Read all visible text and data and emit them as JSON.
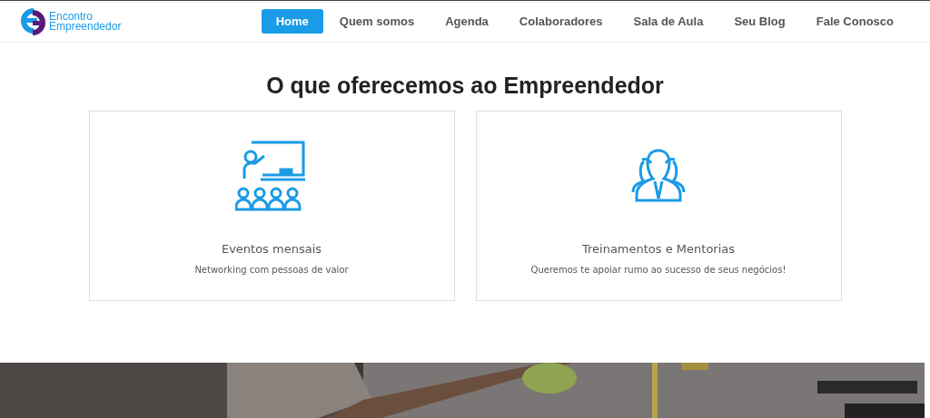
{
  "logo": {
    "line_1": "Encontro",
    "line_2": "Empreendedor"
  },
  "nav": [
    {
      "label": "Home",
      "selected": true
    },
    {
      "label": "Quem somos",
      "selected": false
    },
    {
      "label": "Agenda",
      "selected": false
    },
    {
      "label": "Colaboradores",
      "selected": false
    },
    {
      "label": "Sala de Aula",
      "selected": false
    },
    {
      "label": "Seu Blog",
      "selected": false
    },
    {
      "label": "Fale Conosco",
      "selected": false
    }
  ],
  "section": {
    "title": "O que oferecemos ao Empreendedor",
    "cards": [
      {
        "kind": "classroom",
        "title": "Eventos mensais",
        "text": "Networking com pessoas de valor"
      },
      {
        "kind": "team",
        "title": "Treinamentos e Mentorias",
        "text": "Queremos te apoiar rumo ao sucesso de seus negócios!"
      }
    ]
  }
}
